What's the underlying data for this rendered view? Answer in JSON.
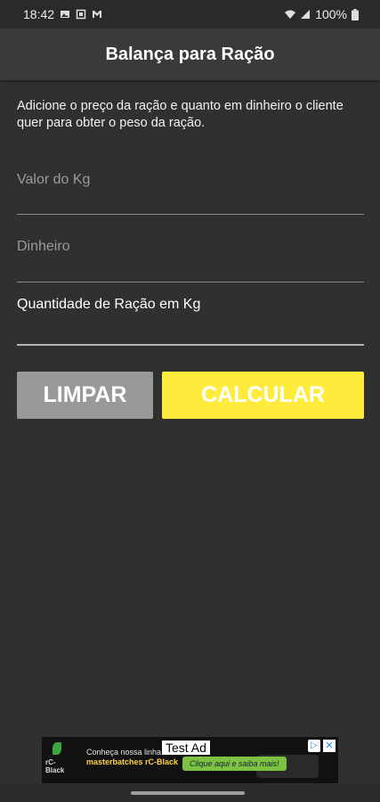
{
  "status": {
    "time": "18:42",
    "battery": "100%",
    "left_icons": [
      "image-icon",
      "screenshot-icon",
      "mail-icon"
    ],
    "right_icons": [
      "wifi-icon",
      "signal-icon",
      "battery-icon"
    ]
  },
  "appbar": {
    "title": "Balança para Ração"
  },
  "main": {
    "description": "Adicione o preço da ração e quanto em dinheiro o cliente quer para obter o peso da ração.",
    "price_field": {
      "placeholder": "Valor do Kg",
      "value": ""
    },
    "money_field": {
      "placeholder": "Dinheiro",
      "value": ""
    },
    "result_label": "Quantidade de Ração em Kg",
    "clear_button": "LIMPAR",
    "calculate_button": "CALCULAR"
  },
  "ad": {
    "label": "Test Ad",
    "brand": "rC-Black",
    "line1": "Conheça nossa linha de",
    "line2": "masterbatches rC-Black",
    "cta": "Clique aqui e saiba mais!"
  },
  "colors": {
    "background": "#303030",
    "appbar": "#3a3a3a",
    "clear_button": "#999999",
    "calculate_button": "#ffeb3b"
  }
}
